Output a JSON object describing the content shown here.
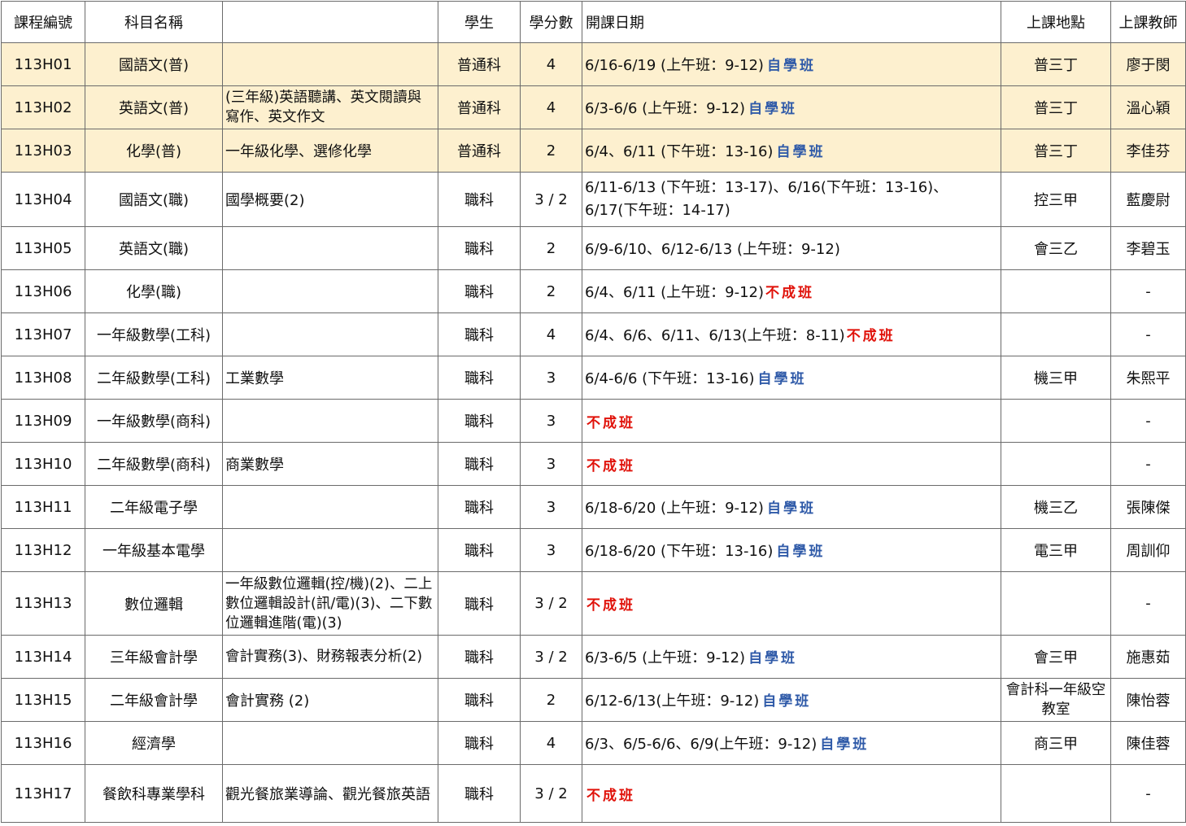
{
  "headers": {
    "code": "課程編號",
    "name": "科目名稱",
    "content": "",
    "students": "學生",
    "credits": "學分數",
    "date": "開課日期",
    "location": "上課地點",
    "teacher": "上課教師"
  },
  "colors": {
    "highlight": "#fdf0cf",
    "self_study": "#2f5aa8",
    "cancelled": "#e0120a",
    "grid": "#6b6b6b"
  },
  "rows": [
    {
      "code": "113H01",
      "name": "國語文(普)",
      "content": "",
      "students": "普通科",
      "credits": "4",
      "date": "6/16-6/19 (上午班：9-12)",
      "self": "自學班",
      "cancel": "",
      "location": "普三丁",
      "teacher": "廖于閔"
    },
    {
      "code": "113H02",
      "name": "英語文(普)",
      "content": "(三年級)英語聽講、英文閱讀與寫作、英文作文",
      "students": "普通科",
      "credits": "4",
      "date": "6/3-6/6 (上午班：9-12)",
      "self": "自學班",
      "cancel": "",
      "location": "普三丁",
      "teacher": "溫心穎"
    },
    {
      "code": "113H03",
      "name": "化學(普)",
      "content": "一年級化學、選修化學",
      "students": "普通科",
      "credits": "2",
      "date": "6/4、6/11 (下午班：13-16)",
      "self": "自學班",
      "cancel": "",
      "location": "普三丁",
      "teacher": "李佳芬"
    },
    {
      "code": "113H04",
      "name": "國語文(職)",
      "content": "國學概要(2)",
      "students": "職科",
      "credits": "3 / 2",
      "date": "6/11-6/13 (下午班：13-17)、6/16(下午班：13-16)、6/17(下午班：14-17)",
      "self": "",
      "cancel": "",
      "location": "控三甲",
      "teacher": "藍慶尉"
    },
    {
      "code": "113H05",
      "name": "英語文(職)",
      "content": "",
      "students": "職科",
      "credits": "2",
      "date": "6/9-6/10、6/12-6/13 (上午班：9-12)",
      "self": "",
      "cancel": "",
      "location": "會三乙",
      "teacher": "李碧玉"
    },
    {
      "code": "113H06",
      "name": "化學(職)",
      "content": "",
      "students": "職科",
      "credits": "2",
      "date": "6/4、6/11 (上午班：9-12)",
      "self": "",
      "cancel": "不成班",
      "location": "",
      "teacher": "-"
    },
    {
      "code": "113H07",
      "name": "一年級數學(工科)",
      "content": "",
      "students": "職科",
      "credits": "4",
      "date": "6/4、6/6、6/11、6/13(上午班：8-11)",
      "self": "",
      "cancel": "不成班",
      "location": "",
      "teacher": "-"
    },
    {
      "code": "113H08",
      "name": "二年級數學(工科)",
      "content": "工業數學",
      "students": "職科",
      "credits": "3",
      "date": "6/4-6/6 (下午班：13-16)",
      "self": "自學班",
      "cancel": "",
      "location": "機三甲",
      "teacher": "朱熙平"
    },
    {
      "code": "113H09",
      "name": "一年級數學(商科)",
      "content": "",
      "students": "職科",
      "credits": "3",
      "date": "",
      "self": "",
      "cancel": "不成班",
      "location": "",
      "teacher": "-"
    },
    {
      "code": "113H10",
      "name": "二年級數學(商科)",
      "content": "商業數學",
      "students": "職科",
      "credits": "3",
      "date": "",
      "self": "",
      "cancel": "不成班",
      "location": "",
      "teacher": "-"
    },
    {
      "code": "113H11",
      "name": "二年級電子學",
      "content": "",
      "students": "職科",
      "credits": "3",
      "date": "6/18-6/20  (上午班：9-12)",
      "self": "自學班",
      "cancel": "",
      "location": "機三乙",
      "teacher": "張陳傑"
    },
    {
      "code": "113H12",
      "name": "一年級基本電學",
      "content": "",
      "students": "職科",
      "credits": "3",
      "date": "6/18-6/20 (下午班：13-16)",
      "self": "自學班",
      "cancel": "",
      "location": "電三甲",
      "teacher": "周訓仰"
    },
    {
      "code": "113H13",
      "name": "數位邏輯",
      "content": "一年級數位邏輯(控/機)(2)、二上數位邏輯設計(訊/電)(3)、二下數位邏輯進階(電)(3)",
      "students": "職科",
      "credits": "3 / 2",
      "date": "",
      "self": "",
      "cancel": "不成班",
      "location": "",
      "teacher": "-"
    },
    {
      "code": "113H14",
      "name": "三年級會計學",
      "content": "會計實務(3)、財務報表分析(2)",
      "students": "職科",
      "credits": "3 / 2",
      "date": "6/3-6/5 (上午班：9-12)",
      "self": "自學班",
      "cancel": "",
      "location": "會三甲",
      "teacher": "施惠茹"
    },
    {
      "code": "113H15",
      "name": "二年級會計學",
      "content": "會計實務 (2)",
      "students": "職科",
      "credits": "2",
      "date": "6/12-6/13(上午班：9-12)",
      "self": "自學班",
      "cancel": "",
      "location": "會計科一年級空教室",
      "teacher": "陳怡蓉"
    },
    {
      "code": "113H16",
      "name": "經濟學",
      "content": "",
      "students": "職科",
      "credits": "4",
      "date": "6/3、6/5-6/6、6/9(上午班：9-12)",
      "self": "自學班",
      "cancel": "",
      "location": "商三甲",
      "teacher": "陳佳蓉"
    },
    {
      "code": "113H17",
      "name": "餐飲科專業學科",
      "content": "觀光餐旅業導論、觀光餐旅英語",
      "students": "職科",
      "credits": "3 / 2",
      "date": "",
      "self": "",
      "cancel": "不成班",
      "location": "",
      "teacher": "-"
    }
  ]
}
